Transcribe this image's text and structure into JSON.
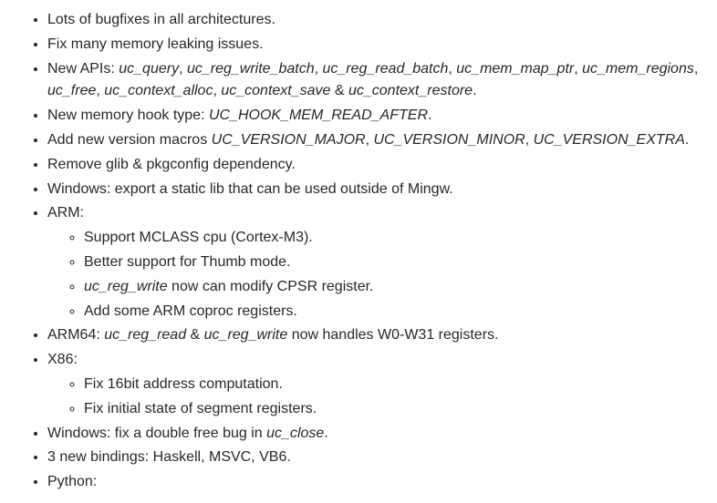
{
  "items": [
    {
      "type": "text",
      "text": "Lots of bugfixes in all architectures."
    },
    {
      "type": "text",
      "text": "Fix many memory leaking issues."
    },
    {
      "type": "api_list",
      "prefix": "New APIs: ",
      "apis": [
        "uc_query",
        "uc_reg_write_batch",
        "uc_reg_read_batch",
        "uc_mem_map_ptr",
        "uc_mem_regions",
        "uc_free",
        "uc_context_alloc",
        "uc_context_save"
      ],
      "last_joiner": " & ",
      "last_api": "uc_context_restore",
      "suffix": "."
    },
    {
      "type": "api_inline",
      "parts": [
        {
          "t": "New memory hook type: "
        },
        {
          "a": "UC_HOOK_MEM_READ_AFTER"
        },
        {
          "t": "."
        }
      ]
    },
    {
      "type": "api_inline",
      "parts": [
        {
          "t": "Add new version macros "
        },
        {
          "a": "UC_VERSION_MAJOR"
        },
        {
          "t": ", "
        },
        {
          "a": "UC_VERSION_MINOR"
        },
        {
          "t": ", "
        },
        {
          "a": "UC_VERSION_EXTRA"
        },
        {
          "t": "."
        }
      ]
    },
    {
      "type": "text",
      "text": "Remove glib & pkgconfig dependency."
    },
    {
      "type": "text",
      "text": "Windows: export a static lib that can be used outside of Mingw."
    },
    {
      "type": "nested",
      "label": "ARM:",
      "children": [
        {
          "type": "text",
          "text": "Support MCLASS cpu (Cortex-M3)."
        },
        {
          "type": "text",
          "text": "Better support for Thumb mode."
        },
        {
          "type": "api_inline",
          "parts": [
            {
              "a": "uc_reg_write"
            },
            {
              "t": " now can modify CPSR register."
            }
          ]
        },
        {
          "type": "text",
          "text": "Add some ARM coproc registers."
        }
      ]
    },
    {
      "type": "api_inline",
      "parts": [
        {
          "t": "ARM64: "
        },
        {
          "a": "uc_reg_read"
        },
        {
          "t": " & "
        },
        {
          "a": "uc_reg_write"
        },
        {
          "t": " now handles W0-W31 registers."
        }
      ]
    },
    {
      "type": "nested",
      "label": "X86:",
      "children": [
        {
          "type": "text",
          "text": "Fix 16bit address computation."
        },
        {
          "type": "text",
          "text": "Fix initial state of segment registers."
        }
      ]
    },
    {
      "type": "api_inline",
      "parts": [
        {
          "t": "Windows: fix a double free bug in "
        },
        {
          "a": "uc_close"
        },
        {
          "t": "."
        }
      ]
    },
    {
      "type": "text",
      "text": "3 new bindings: Haskell, MSVC, VB6."
    },
    {
      "type": "nested",
      "label": "Python:",
      "children": []
    }
  ]
}
